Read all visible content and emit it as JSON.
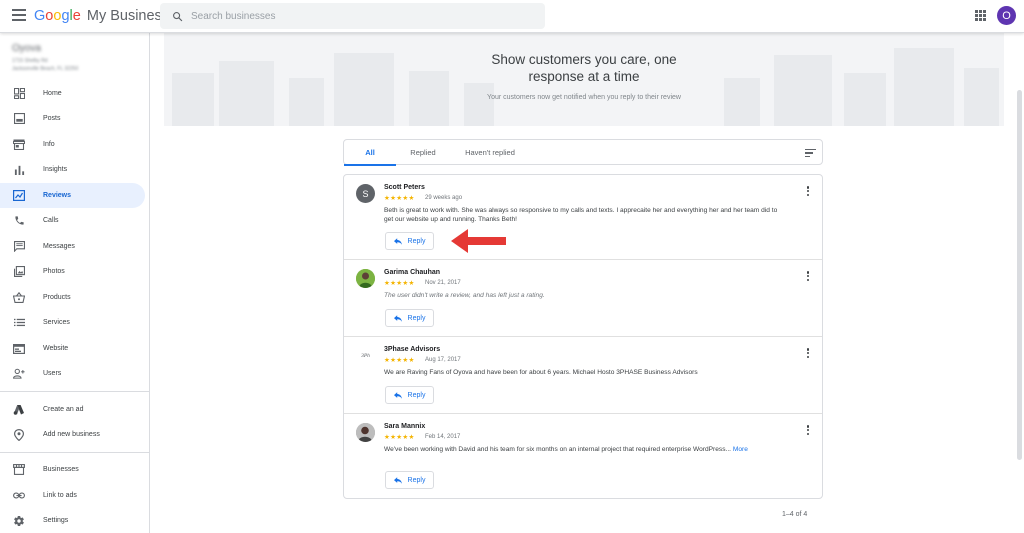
{
  "topbar": {
    "logo_google": "Google",
    "logo_product": "My Business",
    "search_placeholder": "Search businesses",
    "account_initial": "O"
  },
  "sidebar": {
    "business_name": "Oyova",
    "business_address_line1": "1715 Shelby Rd",
    "business_address_line2": "Jacksonville Beach, FL 32250",
    "items": [
      {
        "label": "Home",
        "icon": "dashboard-icon"
      },
      {
        "label": "Posts",
        "icon": "posts-icon"
      },
      {
        "label": "Info",
        "icon": "storefront-icon"
      },
      {
        "label": "Insights",
        "icon": "bar-chart-icon"
      },
      {
        "label": "Reviews",
        "icon": "reviews-icon"
      },
      {
        "label": "Calls",
        "icon": "phone-icon"
      },
      {
        "label": "Messages",
        "icon": "message-icon"
      },
      {
        "label": "Photos",
        "icon": "photos-icon"
      },
      {
        "label": "Products",
        "icon": "basket-icon"
      },
      {
        "label": "Services",
        "icon": "list-icon"
      },
      {
        "label": "Website",
        "icon": "web-icon"
      },
      {
        "label": "Users",
        "icon": "add-user-icon"
      },
      {
        "label": "Create an ad",
        "icon": "google-ads-icon"
      },
      {
        "label": "Add new business",
        "icon": "location-pin-icon"
      },
      {
        "label": "Businesses",
        "icon": "store-icon"
      },
      {
        "label": "Link to ads",
        "icon": "link-icon"
      },
      {
        "label": "Settings",
        "icon": "gear-icon"
      }
    ],
    "active_item": "Reviews"
  },
  "banner": {
    "title_line1": "Show customers you care, one",
    "title_line2": "response at a time",
    "subtitle": "Your customers now get notified when you reply to their review"
  },
  "tabs": [
    {
      "label": "All",
      "active": true
    },
    {
      "label": "Replied",
      "active": false
    },
    {
      "label": "Haven't replied",
      "active": false
    }
  ],
  "reviews": [
    {
      "author": "Scott Peters",
      "avatar_initial": "S",
      "stars": "★★★★★",
      "date": "29 weeks ago",
      "text": "Beth is great to work with. She was always so responsive to my calls and texts. I apprecaite her and everything her and her team did to get our website up and running. Thanks Beth!",
      "reply_label": "Reply"
    },
    {
      "author": "Garima Chauhan",
      "stars": "★★★★★",
      "date": "Nov 21, 2017",
      "text": "The user didn't write a review, and has left just a rating.",
      "reply_label": "Reply"
    },
    {
      "author": "3Phase Advisors",
      "avatar_text": "3Ph",
      "stars": "★★★★★",
      "date": "Aug 17, 2017",
      "text": "We are Raving Fans of Oyova and have been for about 6 years. Michael Hosto 3PHASE Business Advisors",
      "reply_label": "Reply"
    },
    {
      "author": "Sara Mannix",
      "stars": "★★★★★",
      "date": "Feb 14, 2017",
      "text": "We've been working with David and his team for six months on an internal project that required enterprise WordPress...",
      "more_label": "More",
      "reply_label": "Reply"
    }
  ],
  "pagination": "1–4 of 4",
  "colors": {
    "accent": "#1a73e8",
    "star": "#f4b400",
    "active_nav_bg": "#e8f0fe",
    "annotation_arrow": "#e53935"
  }
}
